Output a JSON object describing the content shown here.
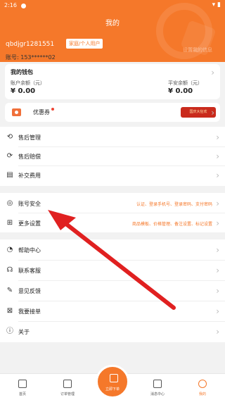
{
  "status_bar": {
    "time": "2:16"
  },
  "header": {
    "title": "我的",
    "user_name": "qbdjgr1281551",
    "user_tag": "家庭/个人用户",
    "faded_text": "设置我的信息",
    "account_label": "账号: 153******02"
  },
  "wallet": {
    "title": "我的钱包",
    "balance_label": "账户余额（元）",
    "balance_value": "¥ 0.00",
    "secure_label": "平安余额（元）",
    "secure_value": "¥ 0.00"
  },
  "coupon": {
    "label": "优惠券",
    "banner_text": "国庆大狂欢"
  },
  "menu": {
    "after_sales": "售后管理",
    "compensation": "售后赔偿",
    "supplement_fee": "补交费用",
    "account_security": "账号安全",
    "account_security_note": "认证、登录手机号、登录密码、支付密码",
    "more_settings": "更多设置",
    "more_settings_note": "商品模板、价格管理、备注设置、标记设置",
    "help": "帮助中心",
    "contact": "联系客服",
    "feedback": "意见反馈",
    "take_orders": "我要接单",
    "about": "关于"
  },
  "tabbar": {
    "home": "首页",
    "orders": "订单管理",
    "place_order": "立即下单",
    "messages": "消息中心",
    "mine": "我的"
  },
  "colors": {
    "brand": "#f5782a",
    "arrow": "#e02020"
  }
}
